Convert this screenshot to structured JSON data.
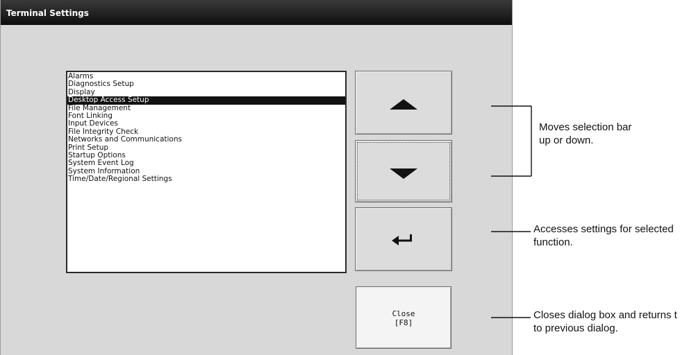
{
  "window": {
    "title": "Terminal Settings"
  },
  "list": {
    "items": [
      "Alarms",
      "Diagnostics Setup",
      "Display",
      "Desktop Access Setup",
      "File Management",
      "Font Linking",
      "Input Devices",
      "File Integrity Check",
      "Networks and Communications",
      "Print Setup",
      "Startup Options",
      "System Event Log",
      "System Information",
      "Time/Date/Regional Settings"
    ],
    "selected_index": 3
  },
  "buttons": {
    "up_icon": "triangle-up-icon",
    "down_icon": "triangle-down-icon",
    "enter_icon": "enter-arrow-icon",
    "close_label": "Close",
    "close_key": "[F8]"
  },
  "callouts": {
    "move": [
      "Moves selection bar",
      "up or down."
    ],
    "access": [
      "Accesses settings for selected",
      "function."
    ],
    "close": [
      "Closes dialog box and returns t",
      "to previous dialog."
    ]
  }
}
